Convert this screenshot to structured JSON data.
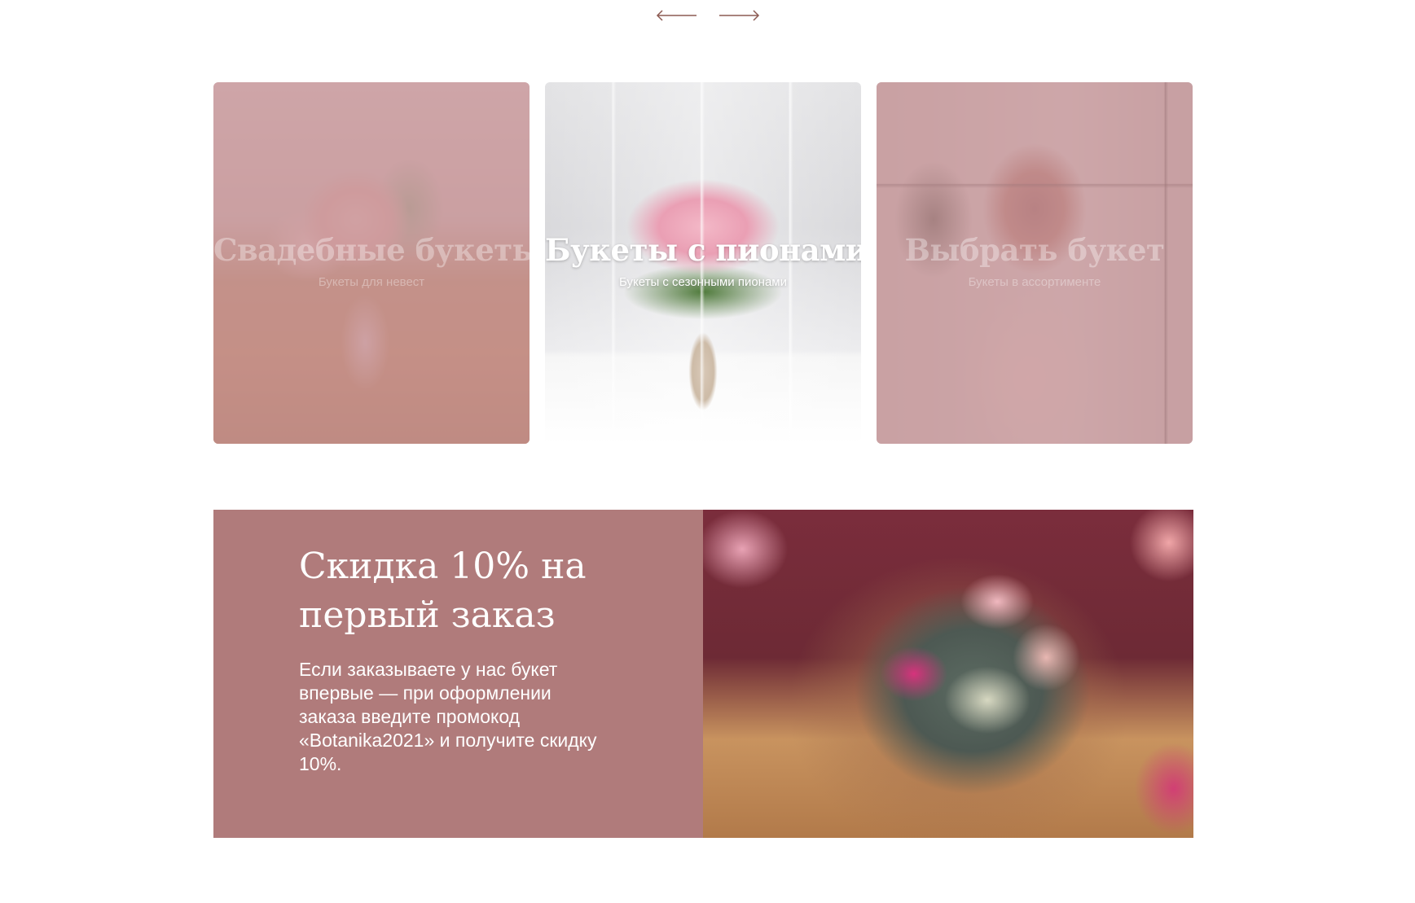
{
  "slider": {
    "prev_icon": "arrow-left-icon",
    "next_icon": "arrow-right-icon",
    "arrow_color": "#8c5a52"
  },
  "cards": [
    {
      "title": "Свадебные букеты",
      "subtitle": "Букеты для невест",
      "active": false
    },
    {
      "title": "Букеты с пионами",
      "subtitle": "Букеты с сезонными пионами",
      "active": true
    },
    {
      "title": "Выбрать букет",
      "subtitle": "Букеты в ассортименте",
      "active": false
    }
  ],
  "promo": {
    "title_line1": "Скидка 10% на",
    "title_line2": "первый заказ",
    "description": "Если заказываете у нас букет впервые — при оформлении заказа введите промокод «Botanika2021» и получите скидку 10%.",
    "bg_color": "#b07b7b"
  },
  "colors": {
    "card_overlay": "#c49297",
    "text_light": "#ffffff"
  }
}
